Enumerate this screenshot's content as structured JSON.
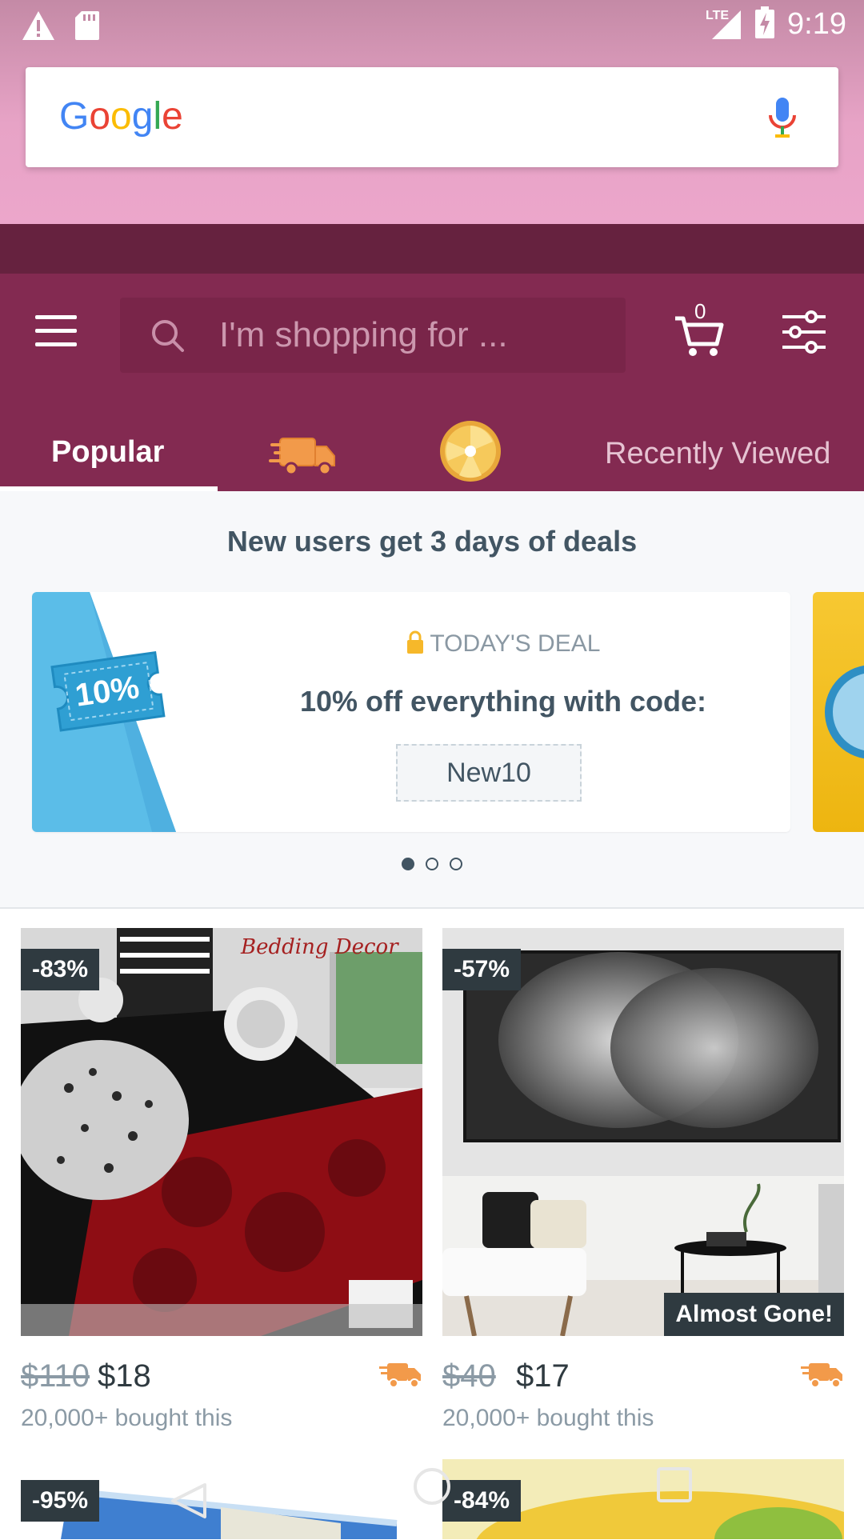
{
  "status_bar": {
    "time": "9:19",
    "network": "LTE",
    "icons": [
      "warning-icon",
      "sd-card-icon",
      "signal-icon",
      "battery-charging-icon"
    ]
  },
  "google_search": {
    "logo_text": "Google",
    "logo_colors": [
      "#4285F4",
      "#EA4335",
      "#FBBC05",
      "#4285F4",
      "#34A853",
      "#EA4335"
    ],
    "mic_icon": "mic-icon"
  },
  "app_header": {
    "search_placeholder": "I'm shopping for ...",
    "cart_count": "0",
    "colors": {
      "header": "#832a51",
      "strip": "#66223f"
    }
  },
  "tabs": [
    {
      "label": "Popular",
      "active": true
    },
    {
      "icon": "shipping-truck-icon"
    },
    {
      "icon": "prize-wheel-icon"
    },
    {
      "label": "Recently Viewed",
      "active": false
    }
  ],
  "deals": {
    "title": "New users get 3 days of deals",
    "ticket_text": "10%",
    "heading": "TODAY'S DEAL",
    "text": "10% off everything with code:",
    "code": "New10",
    "carousel_pages": 3,
    "carousel_active": 1
  },
  "products": [
    {
      "discount": "-83%",
      "old_price": "$110",
      "price": "$18",
      "bought": "20,000+ bought this",
      "image_label": "Bedding Decor",
      "almost_gone": ""
    },
    {
      "discount": "-57%",
      "old_price": "$40",
      "price": "$17",
      "bought": "20,000+ bought this",
      "image_label": "",
      "almost_gone": "Almost Gone!"
    },
    {
      "discount": "-95%"
    },
    {
      "discount": "-84%"
    }
  ],
  "accent_colors": {
    "shipping": "#f29a4a",
    "text_dark": "#425563",
    "badge_bg": "#2f3a40"
  }
}
